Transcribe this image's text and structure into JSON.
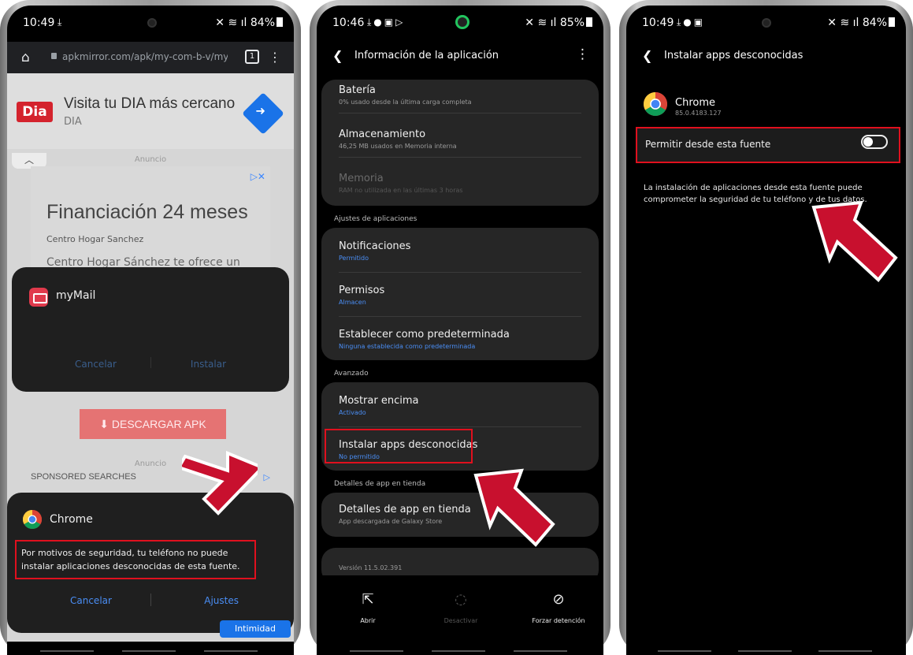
{
  "phone1": {
    "status": {
      "time": "10:49",
      "battery": "84%"
    },
    "browser": {
      "url": "apkmirror.com/apk/my-com-b-v/myma",
      "tab_count": "1"
    },
    "ad1": {
      "logo": "Dia",
      "title": "Visita tu DIA más cercano",
      "subtitle": "DIA"
    },
    "ad_label": "Anuncio",
    "ad2": {
      "headline": "Financiación 24 meses",
      "advertiser": "Centro Hogar Sanchez",
      "body": "Centro Hogar Sánchez te ofrece un amplio"
    },
    "mymail_dialog": {
      "app_name": "myMail",
      "cancel": "Cancelar",
      "install": "Instalar"
    },
    "download_button": "DESCARGAR APK",
    "ad_label_2": "Anuncio",
    "sponsored": "SPONSORED SEARCHES",
    "chrome_dialog": {
      "app_name": "Chrome",
      "message": "Por motivos de seguridad, tu teléfono no puede instalar aplicaciones desconocidas de esta fuente.",
      "cancel": "Cancelar",
      "settings": "Ajustes"
    },
    "privacy": "Intimidad"
  },
  "phone2": {
    "status": {
      "time": "10:46",
      "battery": "85%"
    },
    "title": "Información de la aplicación",
    "rows": [
      {
        "title": "Batería",
        "subtitle": "0% usado desde la última carga completa"
      },
      {
        "title": "Almacenamiento",
        "subtitle": "46,25 MB usados en Memoria interna"
      },
      {
        "title": "Memoria",
        "subtitle": "RAM no utilizada en las últimas 3 horas"
      }
    ],
    "section_app_settings": "Ajustes de aplicaciones",
    "app_rows": [
      {
        "title": "Notificaciones",
        "subtitle": "Permitido"
      },
      {
        "title": "Permisos",
        "subtitle": "Almacen"
      },
      {
        "title": "Establecer como predeterminada",
        "subtitle": "Ninguna establecida como predeterminada"
      }
    ],
    "section_advanced": "Avanzado",
    "adv_rows": [
      {
        "title": "Mostrar encima",
        "subtitle": "Activado"
      },
      {
        "title": "Instalar apps desconocidas",
        "subtitle": "No permitido"
      }
    ],
    "section_store": "Detalles de app en tienda",
    "store_row": {
      "title": "Detalles de app en tienda",
      "subtitle": "App descargada de Galaxy Store"
    },
    "version": "Versión 11.5.02.391",
    "bottom": {
      "open": "Abrir",
      "disable": "Desactivar",
      "force_stop": "Forzar detención"
    }
  },
  "phone3": {
    "status": {
      "time": "10:49",
      "battery": "84%"
    },
    "title": "Instalar apps desconocidas",
    "app": {
      "name": "Chrome",
      "version": "85.0.4183.127"
    },
    "toggle_label": "Permitir desde esta fuente",
    "toggle_on": false,
    "warning": "La instalación de aplicaciones desde esta fuente puede comprometer la seguridad de tu teléfono y de tus datos."
  },
  "colors": {
    "highlight": "#e0101e",
    "arrow": "#c8102e",
    "link": "#4a8ef5"
  }
}
